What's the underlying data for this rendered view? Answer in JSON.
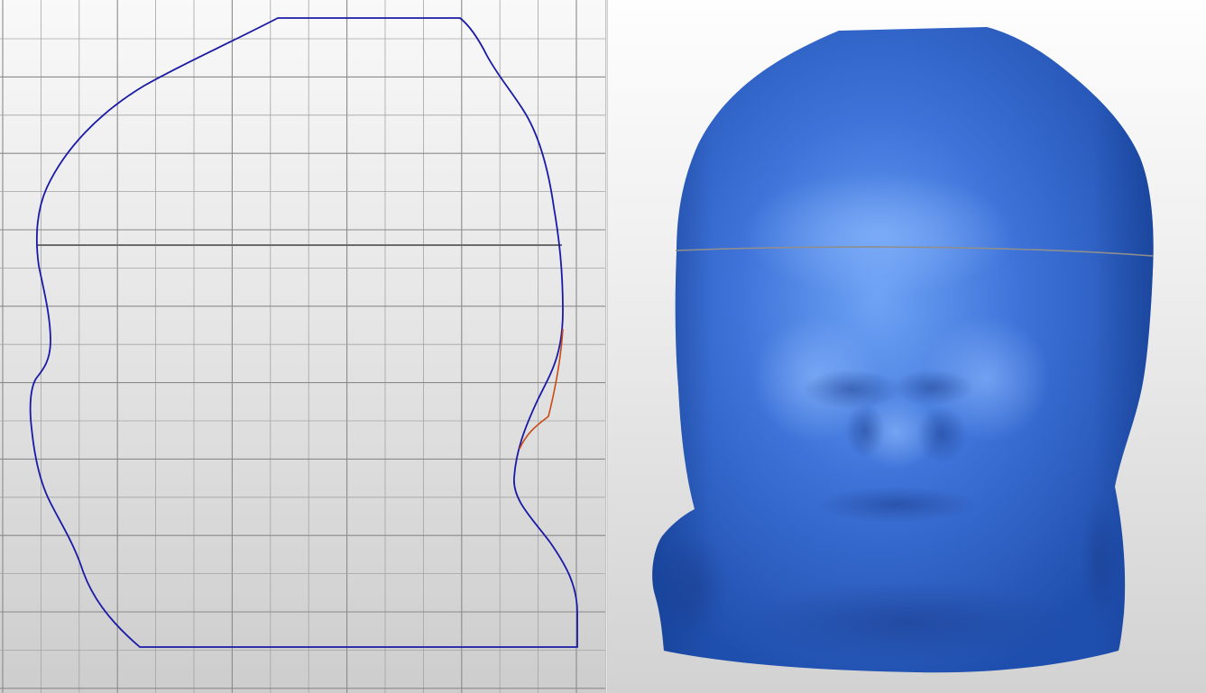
{
  "profile_view": {
    "grid_color": "#a4a4a4",
    "major_grid_color": "#8a8a8a",
    "outline_color": "#1a1aa6",
    "highlight_color": "#c84a14",
    "section_line_color": "#6a6a6a"
  },
  "render_view": {
    "model_color": "#3f73d9",
    "model_highlight_color": "#6ea3f5",
    "model_shadow_color": "#1f4fae",
    "section_line_color": "#8e8e8e"
  }
}
